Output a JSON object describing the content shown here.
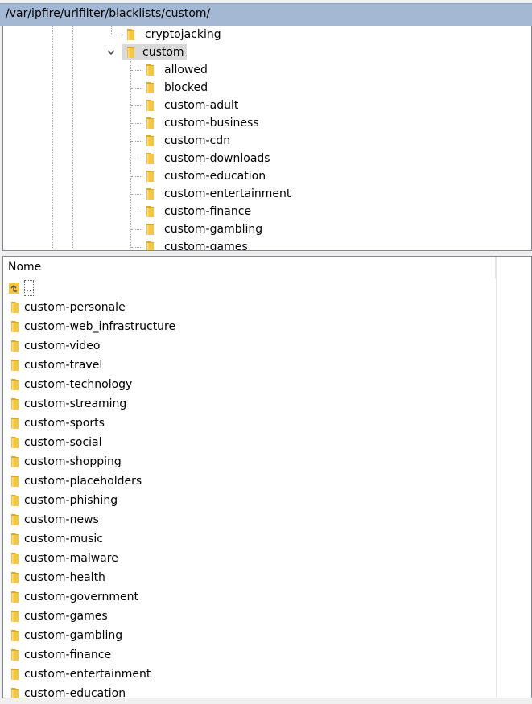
{
  "path_bar": {
    "path": "/var/ipfire/urlfilter/blacklists/custom/"
  },
  "tree": {
    "nodes": [
      {
        "label": "cryptojacking",
        "level": 1
      },
      {
        "label": "custom",
        "level": 1,
        "expanded": true,
        "selected": true
      },
      {
        "label": "allowed",
        "level": 2
      },
      {
        "label": "blocked",
        "level": 2
      },
      {
        "label": "custom-adult",
        "level": 2
      },
      {
        "label": "custom-business",
        "level": 2
      },
      {
        "label": "custom-cdn",
        "level": 2
      },
      {
        "label": "custom-downloads",
        "level": 2
      },
      {
        "label": "custom-education",
        "level": 2
      },
      {
        "label": "custom-entertainment",
        "level": 2
      },
      {
        "label": "custom-finance",
        "level": 2
      },
      {
        "label": "custom-gambling",
        "level": 2
      },
      {
        "label": "custom-games",
        "level": 2
      }
    ]
  },
  "list": {
    "column_header": "Nome",
    "parent_entry": "..",
    "items": [
      "custom-personale",
      "custom-web_infrastructure",
      "custom-video",
      "custom-travel",
      "custom-technology",
      "custom-streaming",
      "custom-sports",
      "custom-social",
      "custom-shopping",
      "custom-placeholders",
      "custom-phishing",
      "custom-news",
      "custom-music",
      "custom-malware",
      "custom-health",
      "custom-government",
      "custom-games",
      "custom-gambling",
      "custom-finance",
      "custom-entertainment",
      "custom-education"
    ]
  },
  "colors": {
    "path_bar": "#a4b8d4",
    "folder": "#f5c642",
    "selection": "#d9d9d9"
  },
  "icons": {
    "folder": "folder-icon",
    "parent": "parent-folder-icon",
    "expander": "chevron-down-icon"
  }
}
